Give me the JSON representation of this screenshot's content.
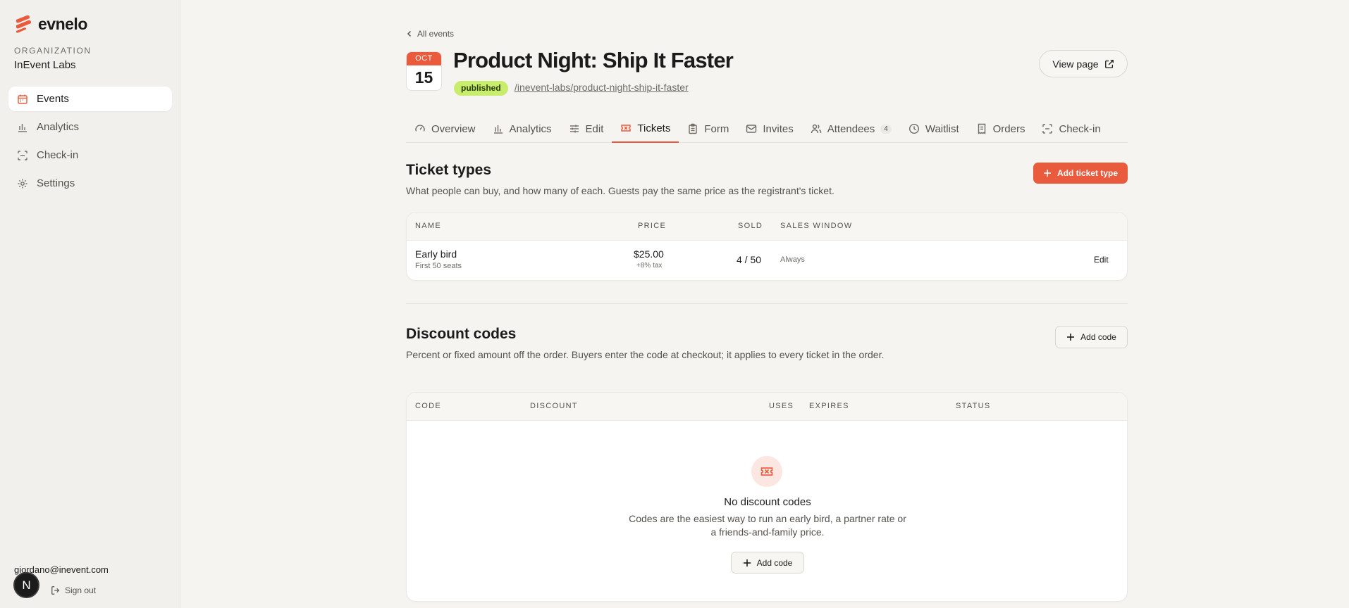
{
  "app": {
    "name": "evnelo",
    "accent_color": "#ea5a3d"
  },
  "sidebar": {
    "org_label": "ORGANIZATION",
    "org_name": "InEvent Labs",
    "items": [
      {
        "label": "Events",
        "icon": "calendar-icon",
        "active": true
      },
      {
        "label": "Analytics",
        "icon": "bar-chart-icon",
        "active": false
      },
      {
        "label": "Check-in",
        "icon": "scan-icon",
        "active": false
      },
      {
        "label": "Settings",
        "icon": "gear-icon",
        "active": false
      }
    ],
    "user_email": "giordano@inevent.com",
    "avatar_initial": "N",
    "sign_out": "Sign out"
  },
  "header": {
    "breadcrumb": "All events",
    "date_month": "OCT",
    "date_day": "15",
    "title": "Product Night: Ship It Faster",
    "status": "published",
    "slug": "/inevent-labs/product-night-ship-it-faster",
    "view_page": "View page"
  },
  "tabs": [
    {
      "label": "Overview",
      "icon": "gauge-icon"
    },
    {
      "label": "Analytics",
      "icon": "bar-chart-icon"
    },
    {
      "label": "Edit",
      "icon": "sliders-icon"
    },
    {
      "label": "Tickets",
      "icon": "ticket-icon",
      "active": true
    },
    {
      "label": "Form",
      "icon": "clipboard-icon"
    },
    {
      "label": "Invites",
      "icon": "mail-icon"
    },
    {
      "label": "Attendees",
      "icon": "users-icon",
      "count": "4"
    },
    {
      "label": "Waitlist",
      "icon": "clock-icon"
    },
    {
      "label": "Orders",
      "icon": "receipt-icon"
    },
    {
      "label": "Check-in",
      "icon": "scan-icon"
    }
  ],
  "ticket_types": {
    "title": "Ticket types",
    "description": "What people can buy, and how many of each. Guests pay the same price as the registrant's ticket.",
    "add_button": "Add ticket type",
    "columns": {
      "name": "NAME",
      "price": "PRICE",
      "sold": "SOLD",
      "sales_window": "SALES WINDOW"
    },
    "rows": [
      {
        "name": "Early bird",
        "subtitle": "First 50 seats",
        "price": "$25.00",
        "tax": "+8% tax",
        "sold": "4 / 50",
        "sales_window": "Always",
        "action": "Edit"
      }
    ]
  },
  "discount_codes": {
    "title": "Discount codes",
    "description": "Percent or fixed amount off the order. Buyers enter the code at checkout; it applies to every ticket in the order.",
    "add_button": "Add code",
    "columns": {
      "code": "CODE",
      "discount": "DISCOUNT",
      "uses": "USES",
      "expires": "EXPIRES",
      "status": "STATUS"
    },
    "empty": {
      "title": "No discount codes",
      "description": "Codes are the easiest way to run an early bird, a partner rate or a friends-and-family price.",
      "button": "Add code"
    }
  }
}
